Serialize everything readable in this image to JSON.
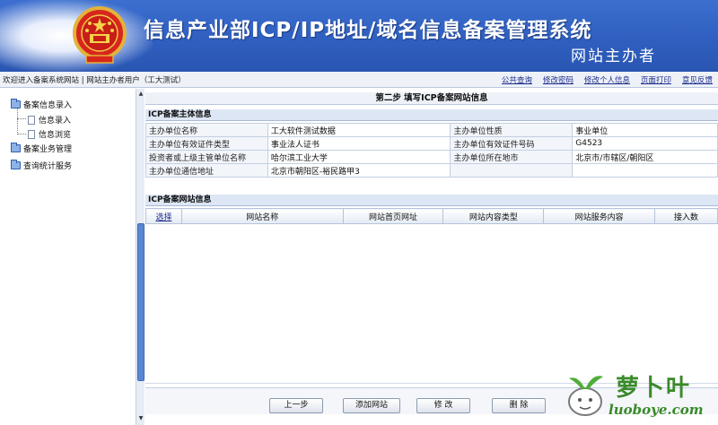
{
  "header": {
    "title": "信息产业部ICP/IP地址/域名信息备案管理系统",
    "subtitle": "网站主办者"
  },
  "toolbar": {
    "welcome": "欢迎进入备案系统网站 | 网站主办者用户（工大测试）",
    "links": [
      "公共查询",
      "修改密码",
      "修改个人信息",
      "页面打印",
      "意见反馈"
    ]
  },
  "sidebar": {
    "items": [
      {
        "label": "备案信息录入",
        "icon": "folder-icon"
      },
      {
        "label": "信息录入",
        "icon": "document-icon"
      },
      {
        "label": "信息浏览",
        "icon": "document-icon"
      },
      {
        "label": "备案业务管理",
        "icon": "folder-icon"
      },
      {
        "label": "查询统计服务",
        "icon": "folder-icon"
      }
    ]
  },
  "main": {
    "step_title": "第二步  填写ICP备案网站信息",
    "subject_section": "ICP备案主体信息",
    "subject_rows": [
      [
        "主办单位名称",
        "工大软件测试数据",
        "主办单位性质",
        "事业单位"
      ],
      [
        "主办单位有效证件类型",
        "事业法人证书",
        "主办单位有效证件号码",
        "G4523"
      ],
      [
        "投资者或上级主管单位名称",
        "哈尔滨工业大学",
        "主办单位所在地市",
        "北京市/市辖区/朝阳区"
      ],
      [
        "主办单位通信地址",
        "北京市朝阳区-裕民路甲3",
        "",
        ""
      ]
    ],
    "site_section": "ICP备案网站信息",
    "site_columns": [
      "选择",
      "网站名称",
      "网站首页网址",
      "网站内容类型",
      "网站服务内容",
      "接入数"
    ],
    "buttons": [
      "上一步",
      "添加网站",
      "修 改",
      "删 除"
    ]
  },
  "watermark": {
    "text_cn": "萝卜叶",
    "url": "luoboye.com"
  },
  "colors": {
    "banner": "#2f5fc0",
    "link": "#1a2a8a",
    "section_bg": "#dde6f4",
    "watermark": "#3a8a2a"
  }
}
